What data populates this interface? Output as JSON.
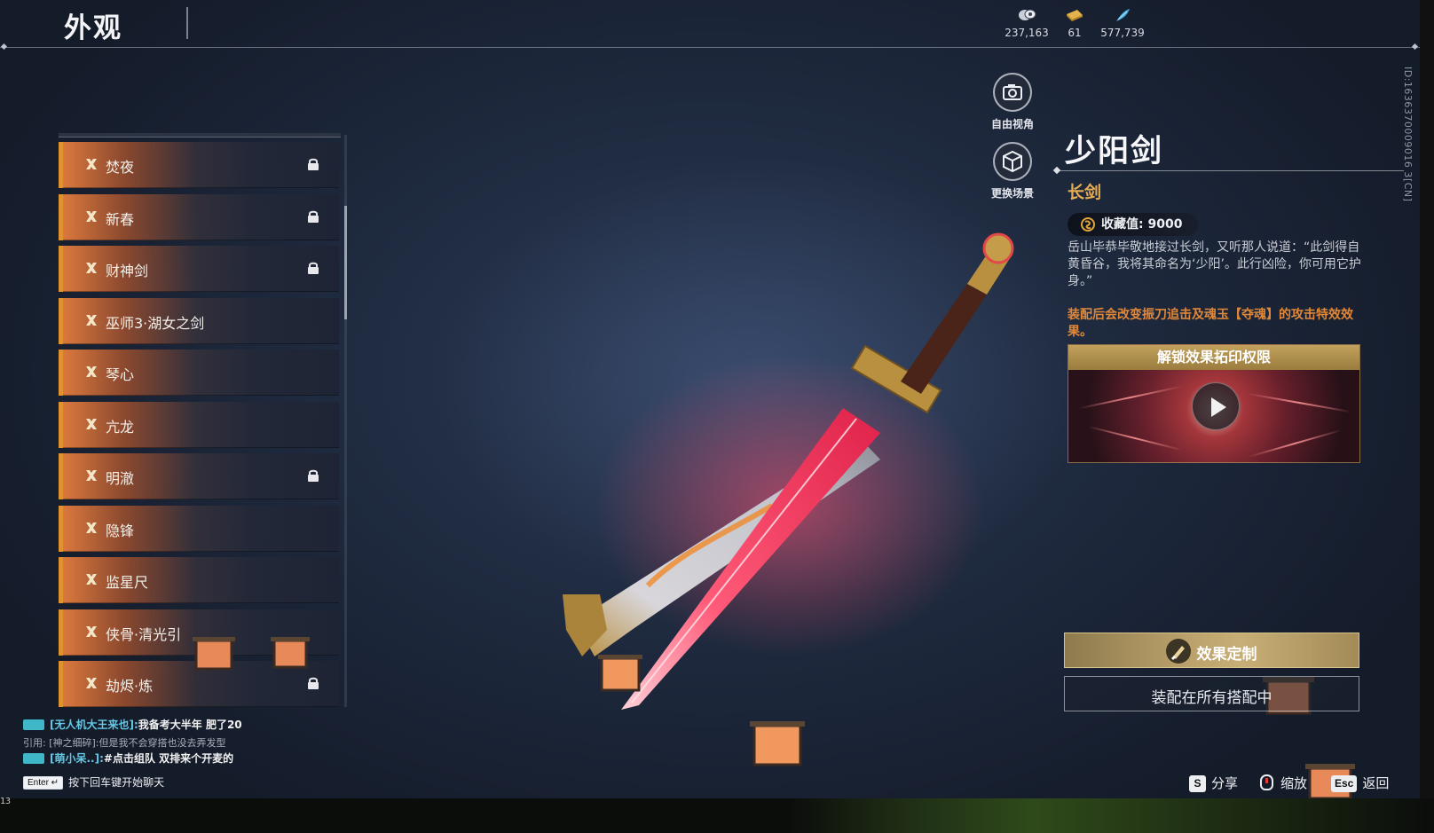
{
  "header": {
    "title": "外观",
    "currencies": [
      {
        "icon": "coin-icon",
        "value": "237,163"
      },
      {
        "icon": "ticket-icon",
        "value": "61"
      },
      {
        "icon": "feather-icon",
        "value": "577,739"
      }
    ]
  },
  "side_id": "ID:1636370009016 3[CN]",
  "list": {
    "items": [
      {
        "label": "焚夜",
        "locked": true
      },
      {
        "label": "新春",
        "locked": true
      },
      {
        "label": "财神剑",
        "locked": true
      },
      {
        "label": "巫师3·湖女之剑",
        "locked": false
      },
      {
        "label": "琴心",
        "locked": false
      },
      {
        "label": "亢龙",
        "locked": false
      },
      {
        "label": "明澈",
        "locked": true
      },
      {
        "label": "隐锋",
        "locked": false
      },
      {
        "label": "监星尺",
        "locked": false
      },
      {
        "label": "侠骨·清光引",
        "locked": false
      },
      {
        "label": "劫烬·炼",
        "locked": true
      }
    ]
  },
  "view_controls": {
    "free_view": "自由视角",
    "change_scene": "更换场景"
  },
  "detail": {
    "name": "少阳剑",
    "type": "长剑",
    "collection": "收藏值: 9000",
    "description": "岳山毕恭毕敬地接过长剑，又听那人说道：“此剑得自黄昏谷，我将其命名为‘少阳’。此行凶险，你可用它护身。”",
    "effect_note": "装配后会改变振刀追击及魂玉【夺魂】的攻击特效效果。",
    "unlock_title": "解锁效果拓印权限",
    "customize_label": "效果定制",
    "equipped_label": "装配在所有搭配中"
  },
  "chat": {
    "lines": [
      {
        "name": "[无人机大王来也]:",
        "message": "我备考大半年 肥了20"
      },
      {
        "quote": "引用: [神之细碎]:但是我不会穿搭也没去弄发型"
      },
      {
        "name": "[萌小呆..]:",
        "message": "#点击组队 双排来个开麦的"
      }
    ],
    "enter_key": "Enter ↵",
    "hint": "按下回车键开始聊天"
  },
  "hints": {
    "share_key": "S",
    "share": "分享",
    "zoom": "缩放",
    "back_key": "Esc",
    "back": "返回"
  },
  "frame_number": "13",
  "colors": {
    "accent_orange": "#e0922e",
    "gold": "#e7ad52",
    "effect_text": "#e0883a"
  }
}
